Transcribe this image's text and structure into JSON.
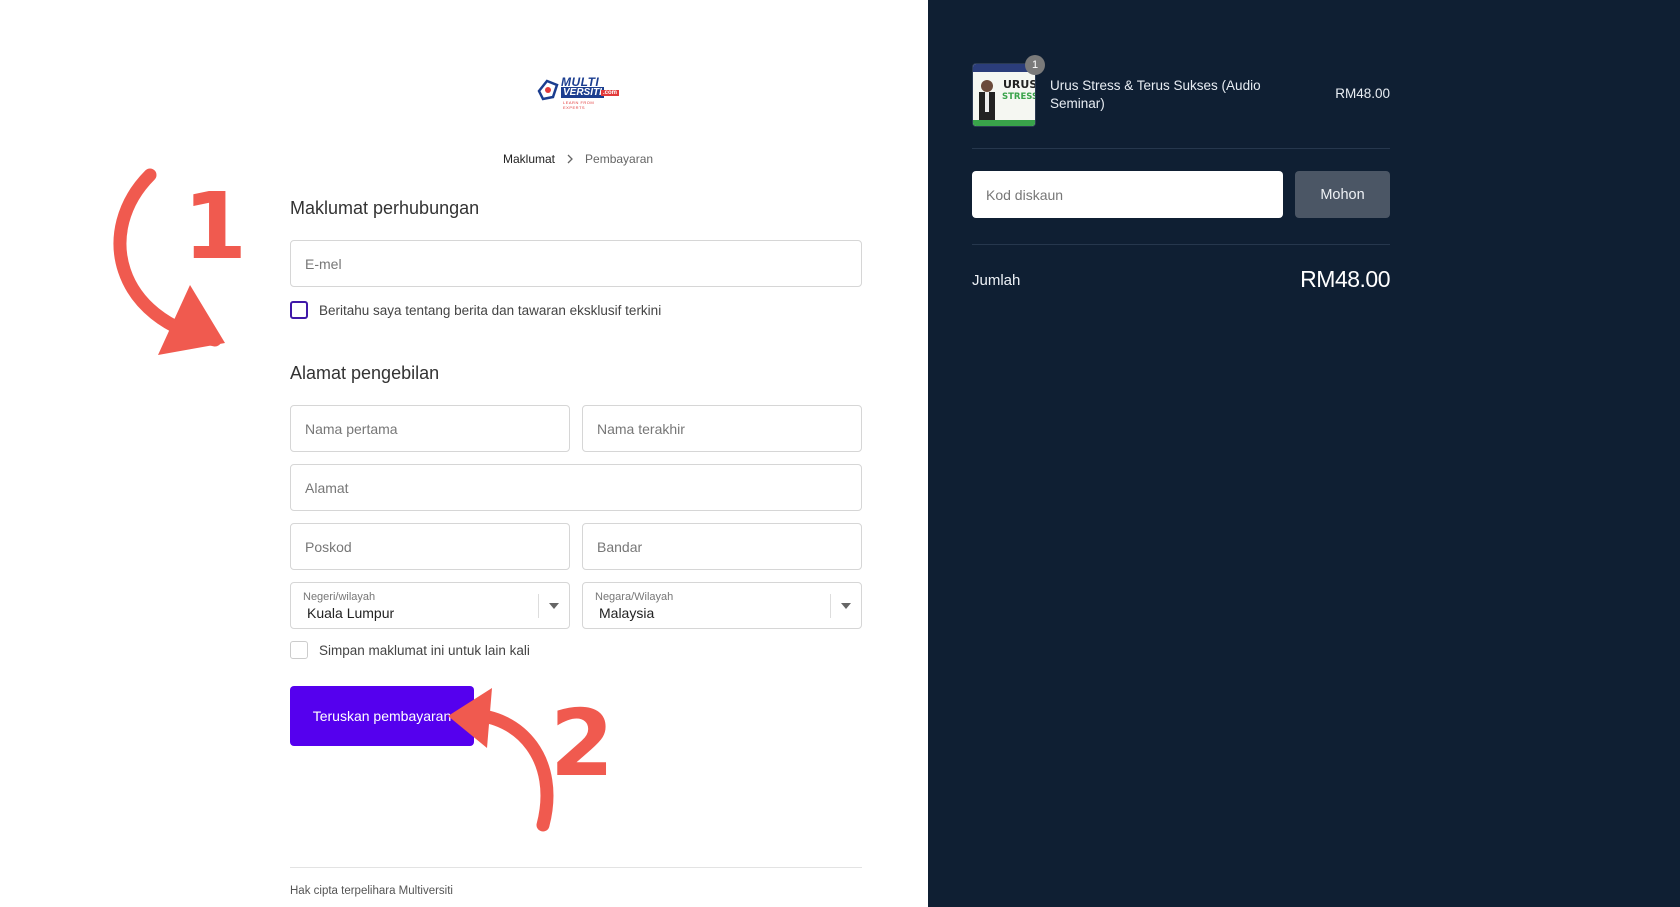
{
  "logo": {
    "line1": "MULTI",
    "line2": "VERSITI",
    "line3": ".com",
    "tagline": "LEARN FROM EXPERTS"
  },
  "breadcrumb": {
    "step1": "Maklumat",
    "step2": "Pembayaran"
  },
  "contact": {
    "title": "Maklumat perhubungan",
    "email_placeholder": "E-mel",
    "newsletter_label": "Beritahu saya tentang berita dan tawaran eksklusif terkini"
  },
  "billing": {
    "title": "Alamat pengebilan",
    "first_name_placeholder": "Nama pertama",
    "last_name_placeholder": "Nama terakhir",
    "address_placeholder": "Alamat",
    "postcode_placeholder": "Poskod",
    "city_placeholder": "Bandar",
    "state_label": "Negeri/wilayah",
    "state_value": "Kuala Lumpur",
    "country_label": "Negara/Wilayah",
    "country_value": "Malaysia",
    "save_label": "Simpan maklumat ini untuk lain kali"
  },
  "continue_button": "Teruskan pembayaran",
  "footer": {
    "copyright": "Hak cipta terpelihara Multiversiti"
  },
  "annotations": {
    "step1": "1",
    "step2": "2",
    "color": "#f05a4f"
  },
  "summary": {
    "product": {
      "name": "Urus Stress & Terus Sukses (Audio Seminar)",
      "price": "RM48.00",
      "quantity": "1",
      "thumb_text1": "URUS",
      "thumb_text2": "STRESS"
    },
    "discount_placeholder": "Kod diskaun",
    "apply_label": "Mohon",
    "total_label": "Jumlah",
    "total_value": "RM48.00"
  },
  "colors": {
    "primary_button": "#5500ee",
    "sidebar_bg": "#0f1f33",
    "apply_button": "#4b5665"
  }
}
